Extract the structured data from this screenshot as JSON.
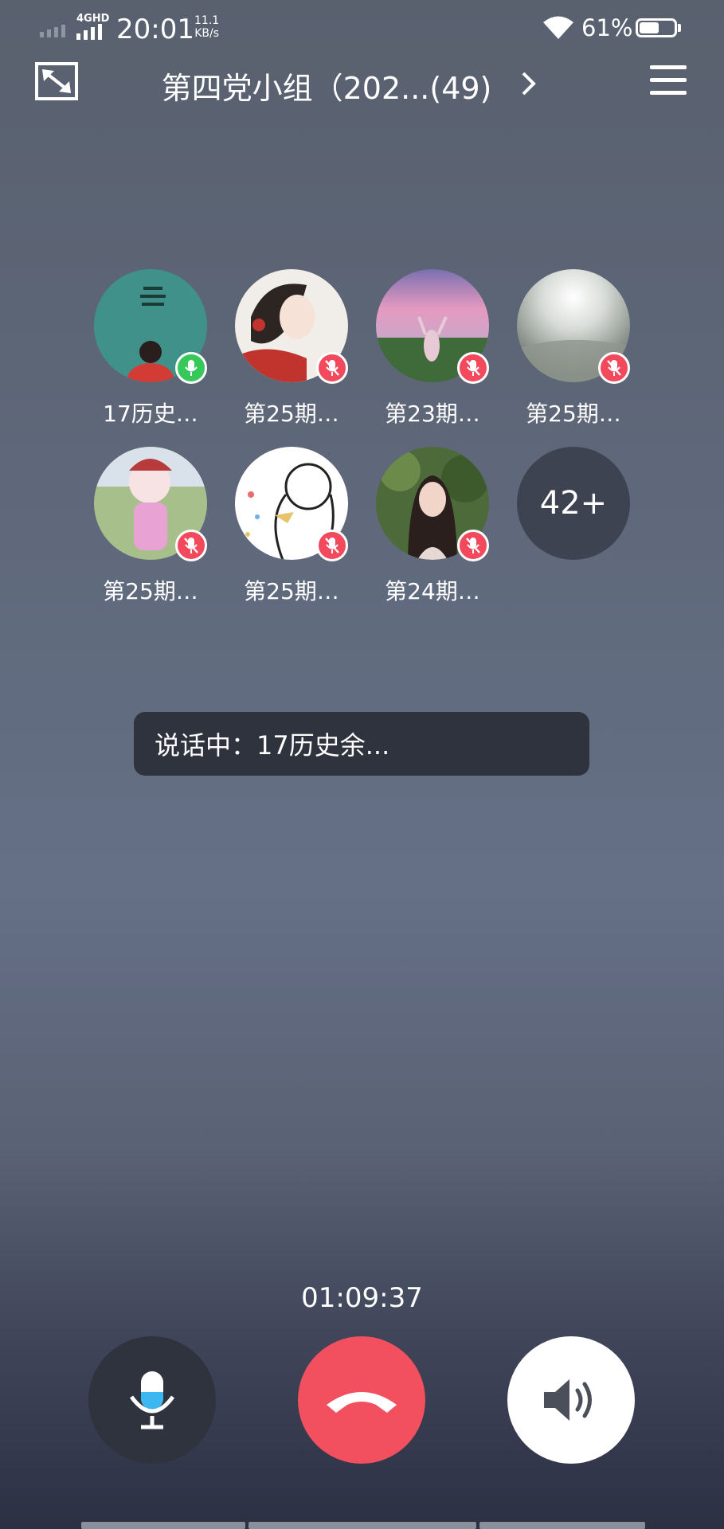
{
  "status_bar": {
    "network_type": "4GHD",
    "time": "20:01",
    "speed_value": "11.1",
    "speed_unit": "KB/s",
    "battery_percent": "61%",
    "battery_level": 0.61
  },
  "header": {
    "title": "第四党小组（202...(49)"
  },
  "participants": [
    {
      "name": "17历史…",
      "mic": "on",
      "avatar": "avatar-cartoon-girl"
    },
    {
      "name": "第25期…",
      "mic": "off",
      "avatar": "avatar-anime-girl"
    },
    {
      "name": "第23期…",
      "mic": "off",
      "avatar": "avatar-sunset-field"
    },
    {
      "name": "第25期…",
      "mic": "off",
      "avatar": "avatar-sea-sunlight"
    },
    {
      "name": "第25期…",
      "mic": "off",
      "avatar": "avatar-cartoon-pink"
    },
    {
      "name": "第25期…",
      "mic": "off",
      "avatar": "avatar-sketch-character"
    },
    {
      "name": "第24期…",
      "mic": "off",
      "avatar": "avatar-portrait-woman"
    }
  ],
  "more_count": "42+",
  "speaking": {
    "text": "说话中：17历史余..."
  },
  "call": {
    "duration": "01:09:37"
  },
  "colors": {
    "hangup": "#f2505f",
    "mic_on": "#36c95a",
    "mic_off": "#f2495c",
    "mic_button_accent": "#3bb8f0"
  }
}
